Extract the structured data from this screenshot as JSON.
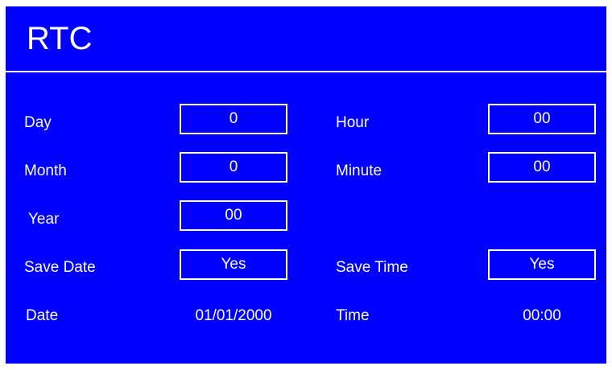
{
  "header": {
    "title": "RTC"
  },
  "date_section": {
    "day": {
      "label": "Day",
      "value": "0"
    },
    "month": {
      "label": "Month",
      "value": "0"
    },
    "year": {
      "label": "Year",
      "value": "00"
    },
    "save_date": {
      "label": "Save Date",
      "value": "Yes"
    },
    "date_readout": {
      "label": "Date",
      "value": "01/01/2000"
    }
  },
  "time_section": {
    "hour": {
      "label": "Hour",
      "value": "00"
    },
    "minute": {
      "label": "Minute",
      "value": "00"
    },
    "save_time": {
      "label": "Save Time",
      "value": "Yes"
    },
    "time_readout": {
      "label": "Time",
      "value": "00:00"
    }
  },
  "colors": {
    "background": "#0000ff",
    "foreground": "#ffffff"
  }
}
